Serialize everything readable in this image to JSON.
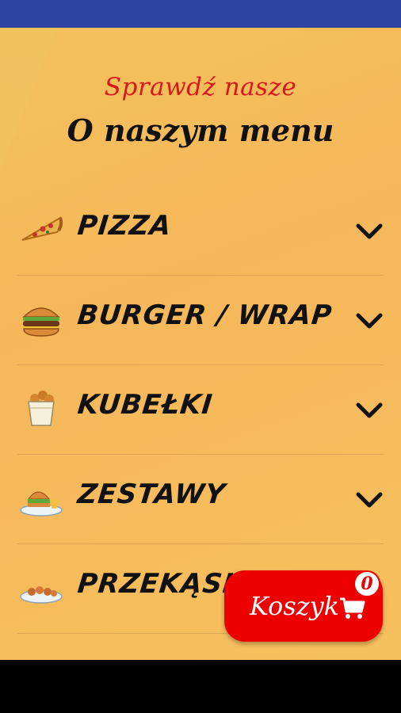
{
  "header": {
    "subtitle": "Sprawdź nasze",
    "title": "O naszym menu"
  },
  "menu": {
    "items": [
      {
        "label": "PIZZA",
        "icon": "pizza-icon"
      },
      {
        "label": "BURGER / WRAP",
        "icon": "burger-icon"
      },
      {
        "label": "KUBEŁKI",
        "icon": "bucket-icon"
      },
      {
        "label": "ZESTAWY",
        "icon": "combo-meal-icon"
      },
      {
        "label": "PRZEKĄSKI",
        "icon": "snacks-icon"
      }
    ]
  },
  "cart": {
    "label": "Koszyk",
    "count": "0",
    "icon": "cart-icon"
  },
  "colors": {
    "status_bar": "#2f43a0",
    "accent_red": "#e00000",
    "subtitle_red": "#d6191c",
    "background": "#f5b75a"
  }
}
